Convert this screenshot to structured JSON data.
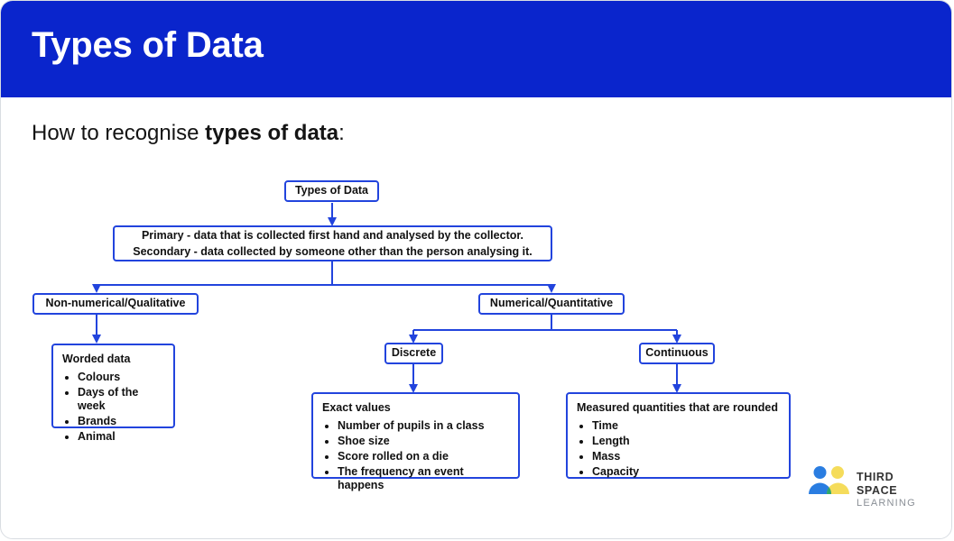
{
  "header": {
    "title": "Types of Data",
    "bg_color": "#0A25CC",
    "text_color": "#FFFFFF"
  },
  "subtitle": {
    "prefix": "How to recognise ",
    "emphasis": "types of data",
    "suffix": ":"
  },
  "diagram": {
    "border_color": "#2244DD",
    "connector_color": "#2244DD",
    "nodes": {
      "root": {
        "label": "Types of Data"
      },
      "primary_secondary": {
        "line1": "Primary - data that is collected first hand and analysed by the collector.",
        "line2": "Secondary - data collected by someone other than the person analysing it."
      },
      "qualitative": {
        "label": "Non-numerical/Qualitative"
      },
      "quantitative": {
        "label": "Numerical/Quantitative"
      },
      "discrete": {
        "label": "Discrete"
      },
      "continuous": {
        "label": "Continuous"
      },
      "worded_data": {
        "heading": "Worded data",
        "items": [
          "Colours",
          "Days of the week",
          "Brands",
          "Animal"
        ]
      },
      "exact_values": {
        "heading": "Exact values",
        "items": [
          "Number of pupils in a class",
          "Shoe size",
          "Score rolled on a die",
          "The frequency an event happens"
        ]
      },
      "measured_quantities": {
        "heading": "Measured quantities that are rounded",
        "items": [
          "Time",
          "Length",
          "Mass",
          "Capacity"
        ]
      }
    }
  },
  "logo": {
    "line1": "THIRD SPACE",
    "line2": "LEARNING",
    "colors": {
      "blue": "#2A7DE1",
      "yellow": "#F5DC5B",
      "green": "#2FA86B"
    }
  }
}
